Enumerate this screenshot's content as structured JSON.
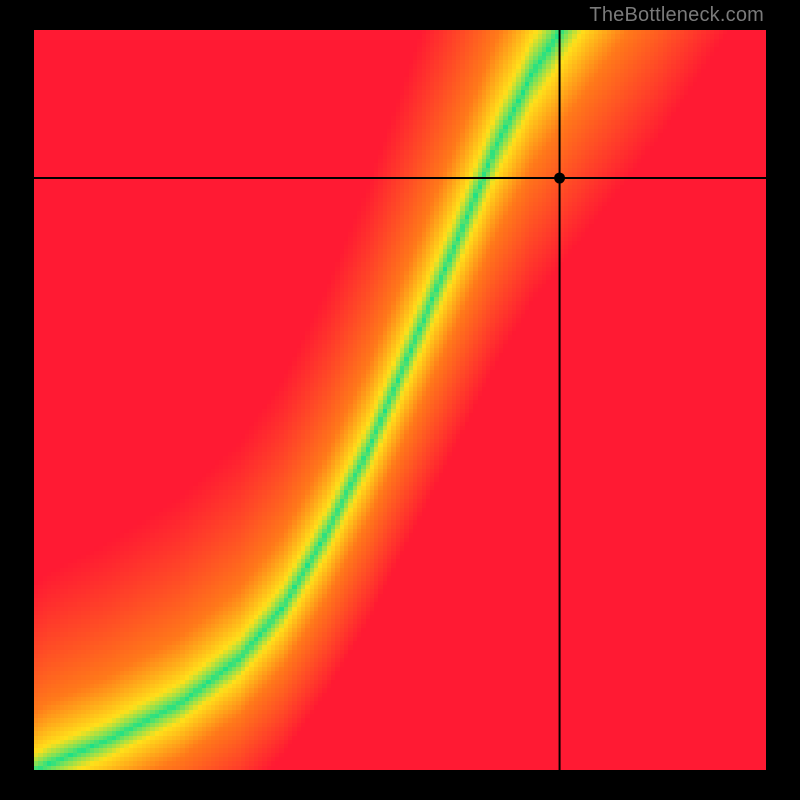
{
  "watermark": "TheBottleneck.com",
  "chart_data": {
    "type": "heatmap",
    "title": "",
    "xlabel": "",
    "ylabel": "",
    "xlim": [
      0,
      1
    ],
    "ylim": [
      0,
      1
    ],
    "ridge": {
      "comment": "Green optimal-match ridge control points (x,y in plot-fraction units, origin bottom-left)",
      "points": [
        [
          0.0,
          0.0
        ],
        [
          0.1,
          0.04
        ],
        [
          0.2,
          0.09
        ],
        [
          0.28,
          0.15
        ],
        [
          0.34,
          0.22
        ],
        [
          0.4,
          0.32
        ],
        [
          0.46,
          0.44
        ],
        [
          0.52,
          0.58
        ],
        [
          0.58,
          0.72
        ],
        [
          0.63,
          0.84
        ],
        [
          0.68,
          0.94
        ],
        [
          0.72,
          1.0
        ]
      ],
      "half_width_frac": 0.035
    },
    "marker": {
      "x_frac": 0.718,
      "y_frac": 0.8
    },
    "crosshair": {
      "x_frac": 0.718,
      "y_frac": 0.8
    },
    "palette": {
      "red": "#ff1a33",
      "orange": "#ff7a1a",
      "yellow": "#ffe01a",
      "green": "#17e28a"
    }
  }
}
